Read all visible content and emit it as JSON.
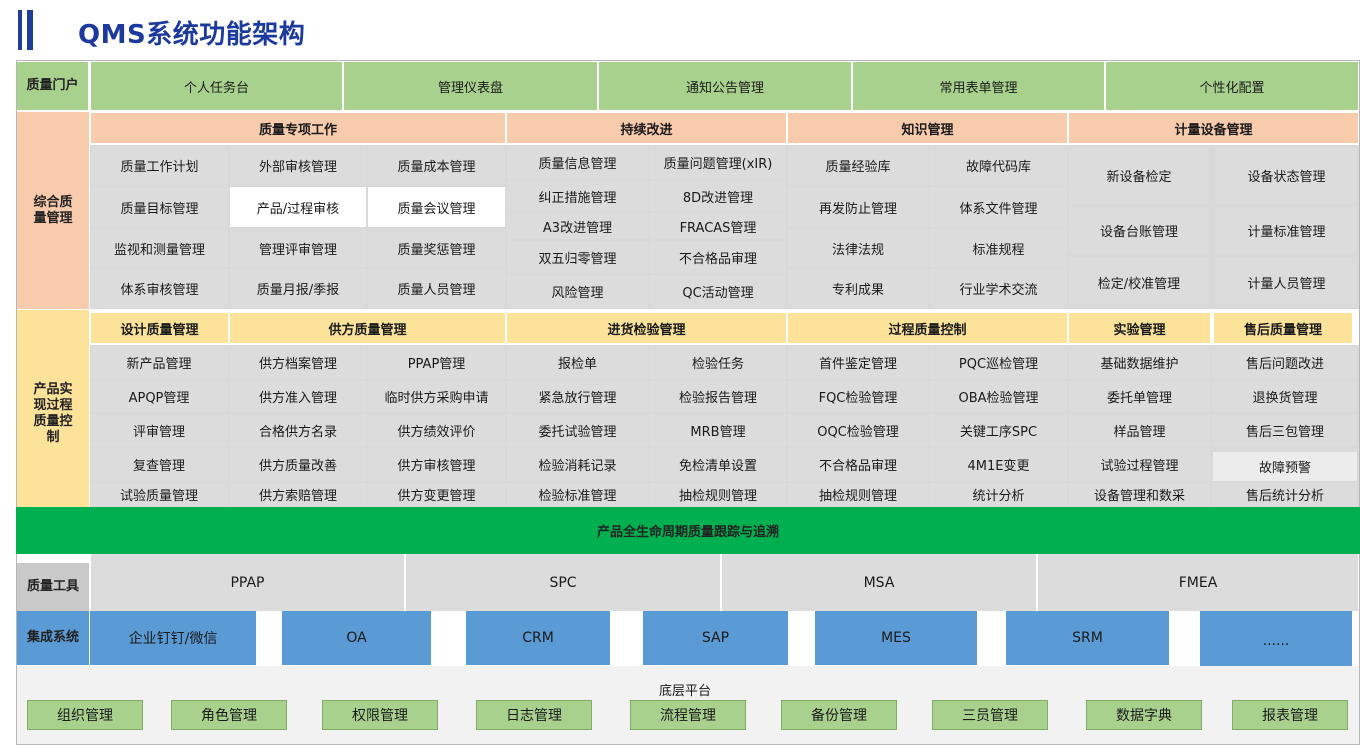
{
  "title": "QMS系统功能架构",
  "portal": {
    "label": "质量门户",
    "items": [
      "个人任务台",
      "管理仪表盘",
      "通知公告管理",
      "常用表单管理",
      "个性化配置"
    ]
  },
  "comprehensive": {
    "label": "综合质量管理",
    "groups": [
      {
        "header": "质量专项工作",
        "cells": [
          "质量工作计划",
          "外部审核管理",
          "质量成本管理",
          "质量目标管理",
          "产品/过程审核",
          "质量会议管理",
          "监视和测量管理",
          "管理评审管理",
          "质量奖惩管理",
          "体系审核管理",
          "质量月报/季报",
          "质量人员管理"
        ]
      },
      {
        "header": "持续改进",
        "cells": [
          "质量信息管理",
          "质量问题管理(xIR)",
          "纠正措施管理",
          "8D改进管理",
          "A3改进管理",
          "FRACAS管理",
          "双五归零管理",
          "不合格品审理",
          "风险管理",
          "QC活动管理"
        ]
      },
      {
        "header": "知识管理",
        "cells": [
          "质量经验库",
          "故障代码库",
          "再发防止管理",
          "体系文件管理",
          "法律法规",
          "标准规程",
          "专利成果",
          "行业学术交流"
        ]
      },
      {
        "header": "计量设备管理",
        "cells": [
          "新设备检定",
          "设备状态管理",
          "设备台账管理",
          "计量标准管理",
          "检定/校准管理",
          "计量人员管理"
        ]
      }
    ]
  },
  "product": {
    "label": "产品实现过程质量控制",
    "groups": [
      {
        "header": "设计质量管理",
        "cells": [
          "新产品管理",
          "APQP管理",
          "评审管理",
          "复查管理",
          "试验质量管理"
        ]
      },
      {
        "header": "供方质量管理",
        "cells": [
          "供方档案管理",
          "PPAP管理",
          "供方准入管理",
          "临时供方采购申请",
          "合格供方名录",
          "供方绩效评价",
          "供方质量改善",
          "供方审核管理",
          "供方索赔管理",
          "供方变更管理"
        ]
      },
      {
        "header": "进货检验管理",
        "cells": [
          "报检单",
          "检验任务",
          "紧急放行管理",
          "检验报告管理",
          "委托试验管理",
          "MRB管理",
          "检验消耗记录",
          "免检清单设置",
          "检验标准管理",
          "抽检规则管理"
        ]
      },
      {
        "header": "过程质量控制",
        "cells": [
          "首件鉴定管理",
          "PQC巡检管理",
          "FQC检验管理",
          "OBA检验管理",
          "OQC检验管理",
          "关键工序SPC",
          "不合格品审理",
          "4M1E变更",
          "抽检规则管理",
          "统计分析"
        ]
      },
      {
        "header": "实验管理",
        "cells": [
          "基础数据维护",
          "委托单管理",
          "样品管理",
          "试验过程管理",
          "设备管理和数采"
        ]
      },
      {
        "header": "售后质量管理",
        "cells": [
          "售后问题改进",
          "退换货管理",
          "售后三包管理",
          "故障预警",
          "售后统计分析"
        ]
      }
    ]
  },
  "lifecycle": "产品全生命周期质量跟踪与追溯",
  "tools": {
    "label": "质量工具",
    "items": [
      "PPAP",
      "SPC",
      "MSA",
      "FMEA"
    ]
  },
  "integration": {
    "label": "集成系统",
    "items": [
      "企业钉钉/微信",
      "OA",
      "CRM",
      "SAP",
      "MES",
      "SRM",
      "......"
    ]
  },
  "platform": {
    "label": "底层平台",
    "items": [
      "组织管理",
      "角色管理",
      "权限管理",
      "日志管理",
      "流程管理",
      "备份管理",
      "三员管理",
      "数据字典",
      "报表管理"
    ]
  },
  "colors": {
    "title": "#1c3a9e",
    "green": "#a9d18e",
    "peach": "#f8cbad",
    "cream": "#fde39a",
    "blue": "#5b9bd5",
    "lifecycle": "#00b050"
  }
}
